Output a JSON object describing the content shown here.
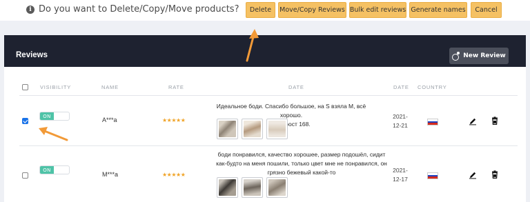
{
  "topbar": {
    "question": "Do you want to Delete/Copy/Move products?",
    "buttons": {
      "delete": "Delete",
      "move_copy": "Move/Copy Reviews",
      "bulk_edit": "Bulk edit reviews",
      "generate": "Generate names",
      "cancel": "Cancel"
    }
  },
  "card": {
    "title": "Reviews",
    "new_review_label": "New Review"
  },
  "table": {
    "columns": [
      "Visibility",
      "Name",
      "Rate",
      "Date",
      "Date",
      "Country"
    ],
    "rows": [
      {
        "selected": true,
        "visibility": "ON",
        "name": "A***a",
        "rating": 5,
        "stars": "★★★★★",
        "text": [
          "Идеальное боди. Спасибо большое, на S взяла M, всё хорошо.",
          "Мой рост 168."
        ],
        "date": [
          "2021-",
          "12-21"
        ],
        "country": "Russia"
      },
      {
        "selected": false,
        "visibility": "ON",
        "name": "M***a",
        "rating": 5,
        "stars": "★★★★★",
        "text": [
          "боди понравился, качество хорошее, размер подошёл, сидит",
          "как-будто на меня пошили, только цвет мне не понравился, он",
          "грязно бежевый какой-то"
        ],
        "date": [
          "2021-",
          "12-17"
        ],
        "country": "Russia"
      }
    ]
  },
  "colors": {
    "action_button": "#f5c163",
    "header_dark": "#1e2230",
    "toggle_on": "#4ec3a7",
    "star": "#f0a326",
    "arrow": "#f29a38"
  },
  "icons": [
    "info-icon",
    "new-review-icon",
    "edit-pen-icon",
    "trash-icon",
    "flag-russia-icon"
  ]
}
